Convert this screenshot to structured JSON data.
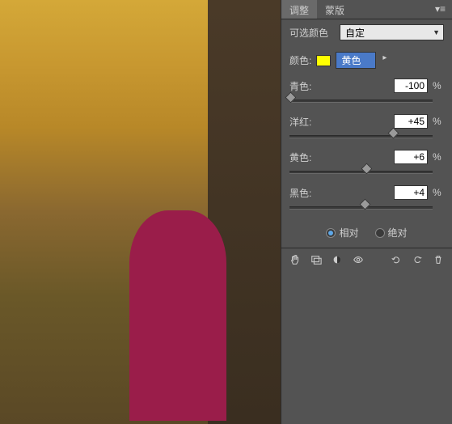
{
  "tabs": {
    "adjust": "调整",
    "mask": "蒙版"
  },
  "selective": {
    "label": "可选颜色",
    "preset": "自定"
  },
  "color": {
    "label": "颜色:",
    "selected": "黄色",
    "swatch": "#ffff00"
  },
  "sliders": {
    "cyan": {
      "label": "青色:",
      "value": "-100",
      "pct": "%",
      "pos": 0
    },
    "magenta": {
      "label": "洋红:",
      "value": "+45",
      "pct": "%",
      "pos": 72
    },
    "yellow": {
      "label": "黄色:",
      "value": "+6",
      "pct": "%",
      "pos": 53
    },
    "black": {
      "label": "黑色:",
      "value": "+4",
      "pct": "%",
      "pos": 52
    }
  },
  "method": {
    "relative": "相对",
    "absolute": "绝对",
    "selected": "relative"
  },
  "icons": {
    "hand": "hand-icon",
    "prev": "view-prev-icon",
    "clip": "clip-icon",
    "eye": "eye-icon",
    "reset": "reset-icon",
    "refresh": "refresh-icon",
    "trash": "trash-icon"
  }
}
